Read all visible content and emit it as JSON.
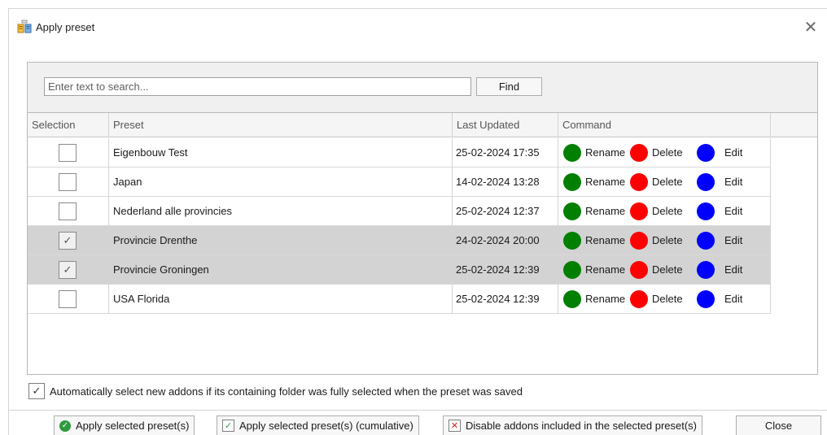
{
  "window": {
    "title": "Apply preset",
    "close_glyph": "✕",
    "icon": "preset-window-icon"
  },
  "search": {
    "placeholder": "Enter text to search...",
    "value": "",
    "find_label": "Find"
  },
  "grid": {
    "columns": [
      "Selection",
      "Preset",
      "Last Updated",
      "Command"
    ],
    "commands": {
      "rename": "Rename",
      "delete": "Delete",
      "edit": "Edit"
    },
    "command_colors": {
      "rename": "#007f00",
      "delete": "#ff0000",
      "edit": "#0000ff"
    },
    "rows": [
      {
        "selected": false,
        "preset": "Eigenbouw Test",
        "last_updated": "25-02-2024 17:35"
      },
      {
        "selected": false,
        "preset": "Japan",
        "last_updated": "14-02-2024 13:28"
      },
      {
        "selected": false,
        "preset": "Nederland alle provincies",
        "last_updated": "25-02-2024 12:37"
      },
      {
        "selected": true,
        "preset": "Provincie Drenthe",
        "last_updated": "24-02-2024 20:00"
      },
      {
        "selected": true,
        "preset": "Provincie Groningen",
        "last_updated": "25-02-2024 12:39"
      },
      {
        "selected": false,
        "preset": "USA Florida",
        "last_updated": "25-02-2024 12:39"
      }
    ]
  },
  "auto_select": {
    "checked": true,
    "label": "Automatically select new addons if its containing folder was fully selected when the preset was saved"
  },
  "footer": {
    "apply_label": "Apply selected preset(s)",
    "apply_cumulative_label": "Apply selected preset(s) (cumulative)",
    "disable_label": "Disable addons included in the selected preset(s)",
    "close_label": "Close"
  },
  "colors": {
    "selected_row": "#d3d3d3",
    "apply_icon": "#2e9a3e",
    "disable_icon": "#d0201f"
  }
}
